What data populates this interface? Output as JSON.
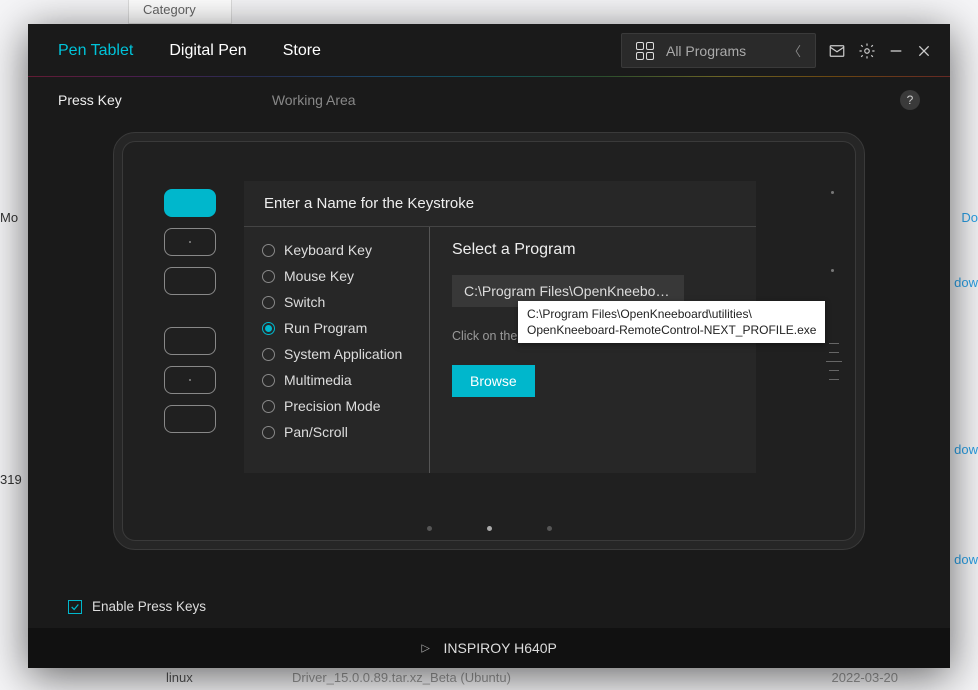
{
  "bg": {
    "category": "Category",
    "mo": "Mo",
    "code": "319",
    "linux": "linux",
    "driver": "Driver_15.0.0.89.tar.xz_Beta (Ubuntu)",
    "date": "2022-03-20",
    "do": "Do",
    "dow": "dow"
  },
  "nav": {
    "pen_tablet": "Pen Tablet",
    "digital_pen": "Digital Pen",
    "store": "Store"
  },
  "program_dd": "All Programs",
  "sub": {
    "press_key": "Press Key",
    "working_area": "Working Area"
  },
  "panel_title": "Enter a Name for the Keystroke",
  "options": {
    "keyboard": "Keyboard Key",
    "mouse": "Mouse Key",
    "switch": "Switch",
    "run": "Run Program",
    "sysapp": "System Application",
    "multimedia": "Multimedia",
    "precision": "Precision Mode",
    "panscroll": "Pan/Scroll"
  },
  "rp": {
    "title": "Select a Program",
    "path": "C:\\Program Files\\OpenKneeboar...",
    "hint": "Click on the \"Browse\" to select a file.",
    "browse": "Browse"
  },
  "tooltip": {
    "l1": "C:\\Program Files\\OpenKneeboard\\utilities\\",
    "l2": "OpenKneeboard-RemoteControl-NEXT_PROFILE.exe"
  },
  "enable_label": "Enable Press Keys",
  "device": "INSPIROY H640P"
}
